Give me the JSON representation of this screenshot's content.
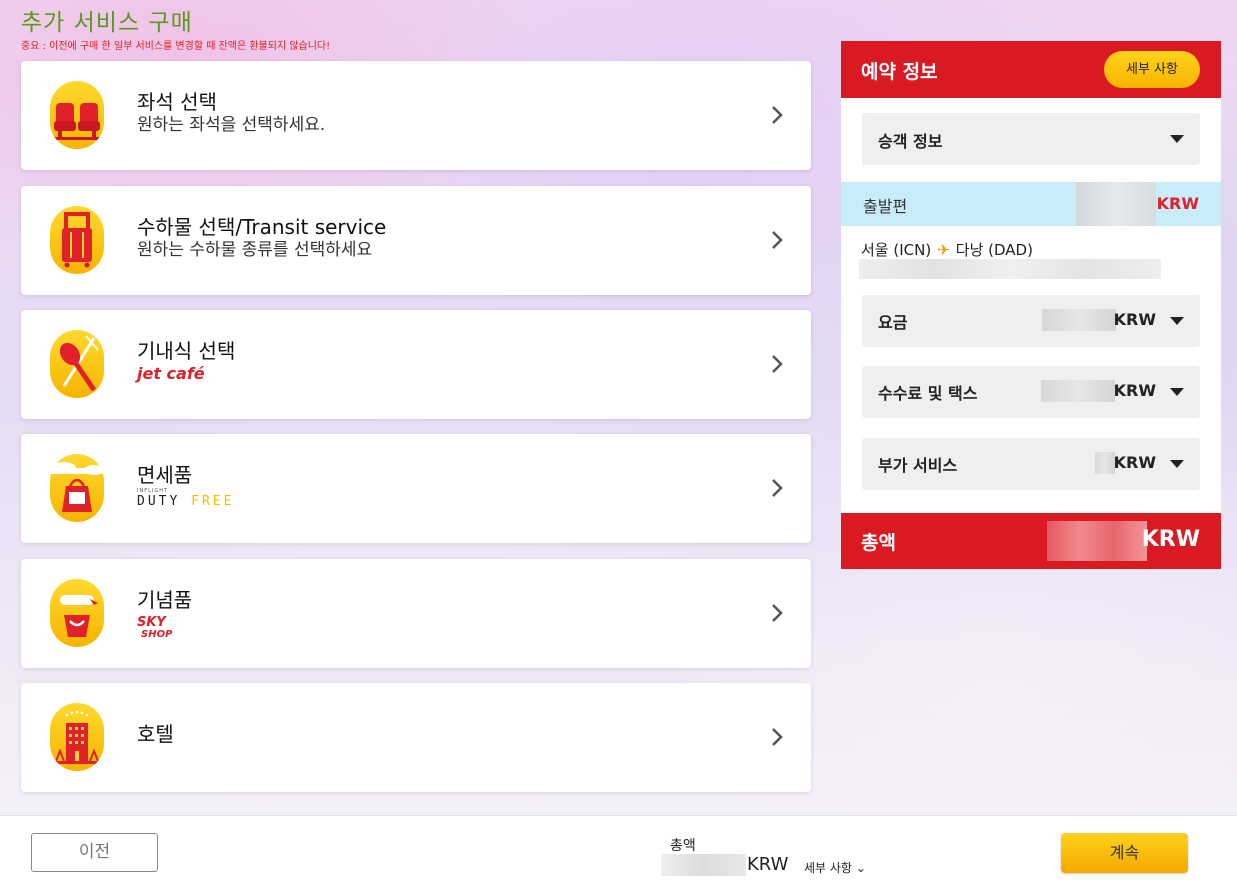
{
  "page": {
    "title": "추가 서비스 구매",
    "notice": "중요 : 이전에 구매 한 일부 서비스를 변경할 때 잔액은 환불되지 않습니다!"
  },
  "services": [
    {
      "title": "좌석 선택",
      "subtitle": "원하는 좌석을 선택하세요.",
      "icon": "seat-icon"
    },
    {
      "title": "수하물 선택/Transit service",
      "subtitle": "원하는 수하물 종류를 선택하세요",
      "icon": "luggage-icon"
    },
    {
      "title": "기내식 선택",
      "brand": "jet café",
      "icon": "meal-icon"
    },
    {
      "title": "면세품",
      "brand_duty": "DUTY",
      "brand_free": "FREE",
      "brand_small": "INFLIGHT",
      "icon": "duty-free-icon"
    },
    {
      "title": "기념품",
      "brand_sky": "SKY",
      "brand_shop": "SHOP",
      "icon": "souvenir-icon"
    },
    {
      "title": "호텔",
      "icon": "hotel-icon"
    }
  ],
  "booking": {
    "title": "예약 정보",
    "detail_label": "세부 사항",
    "passenger_label": "승객 정보",
    "departure_label": "출발편",
    "currency": "KRW",
    "route_from": "서울 (ICN)",
    "route_to": "다낭 (DAD)",
    "fare_label": "요금",
    "fees_label": "수수료 및 택스",
    "addon_label": "부가 서비스",
    "total_label": "총액"
  },
  "footer": {
    "prev_label": "이전",
    "total_label": "총액",
    "currency": "KRW",
    "detail_label": "세부 사항",
    "next_label": "계속"
  },
  "colors": {
    "brand_red": "#da1a22",
    "accent_yellow": "#f8b400",
    "title_green": "#5a9a1a",
    "departure_bg": "#c9ecf9"
  }
}
